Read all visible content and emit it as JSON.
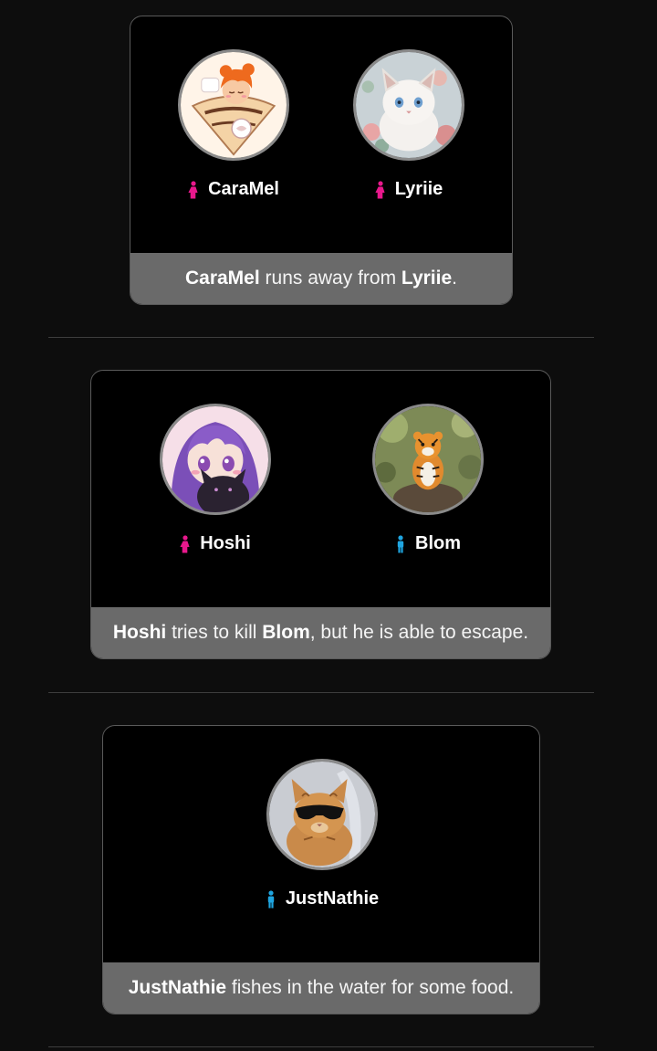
{
  "colors": {
    "background": "#0d0d0d",
    "card": "#000000",
    "event_bar": "#6a6a6a",
    "female": "#e8188c",
    "male": "#1fa5e0"
  },
  "events": [
    {
      "tributes": [
        {
          "name": "CaraMel",
          "gender": "female",
          "gender_icon": "female-icon",
          "avatar": "crepe-girl-avatar"
        },
        {
          "name": "Lyriie",
          "gender": "female",
          "gender_icon": "female-icon",
          "avatar": "white-cat-avatar"
        }
      ],
      "text": {
        "actor": "CaraMel",
        "middle": " runs away from ",
        "target": "Lyriie",
        "end": "."
      }
    },
    {
      "tributes": [
        {
          "name": "Hoshi",
          "gender": "female",
          "gender_icon": "female-icon",
          "avatar": "purple-hair-girl-avatar"
        },
        {
          "name": "Blom",
          "gender": "male",
          "gender_icon": "male-icon",
          "avatar": "tiger-cub-avatar"
        }
      ],
      "text": {
        "actor": "Hoshi",
        "middle": " tries to kill ",
        "target": "Blom",
        "end": ", but he is able to escape."
      }
    },
    {
      "tributes": [
        {
          "name": "JustNathie",
          "gender": "male",
          "gender_icon": "male-icon",
          "avatar": "sunglasses-cat-avatar"
        }
      ],
      "text": {
        "actor": "JustNathie",
        "middle": " fishes in the water for some food.",
        "target": "",
        "end": ""
      }
    }
  ]
}
